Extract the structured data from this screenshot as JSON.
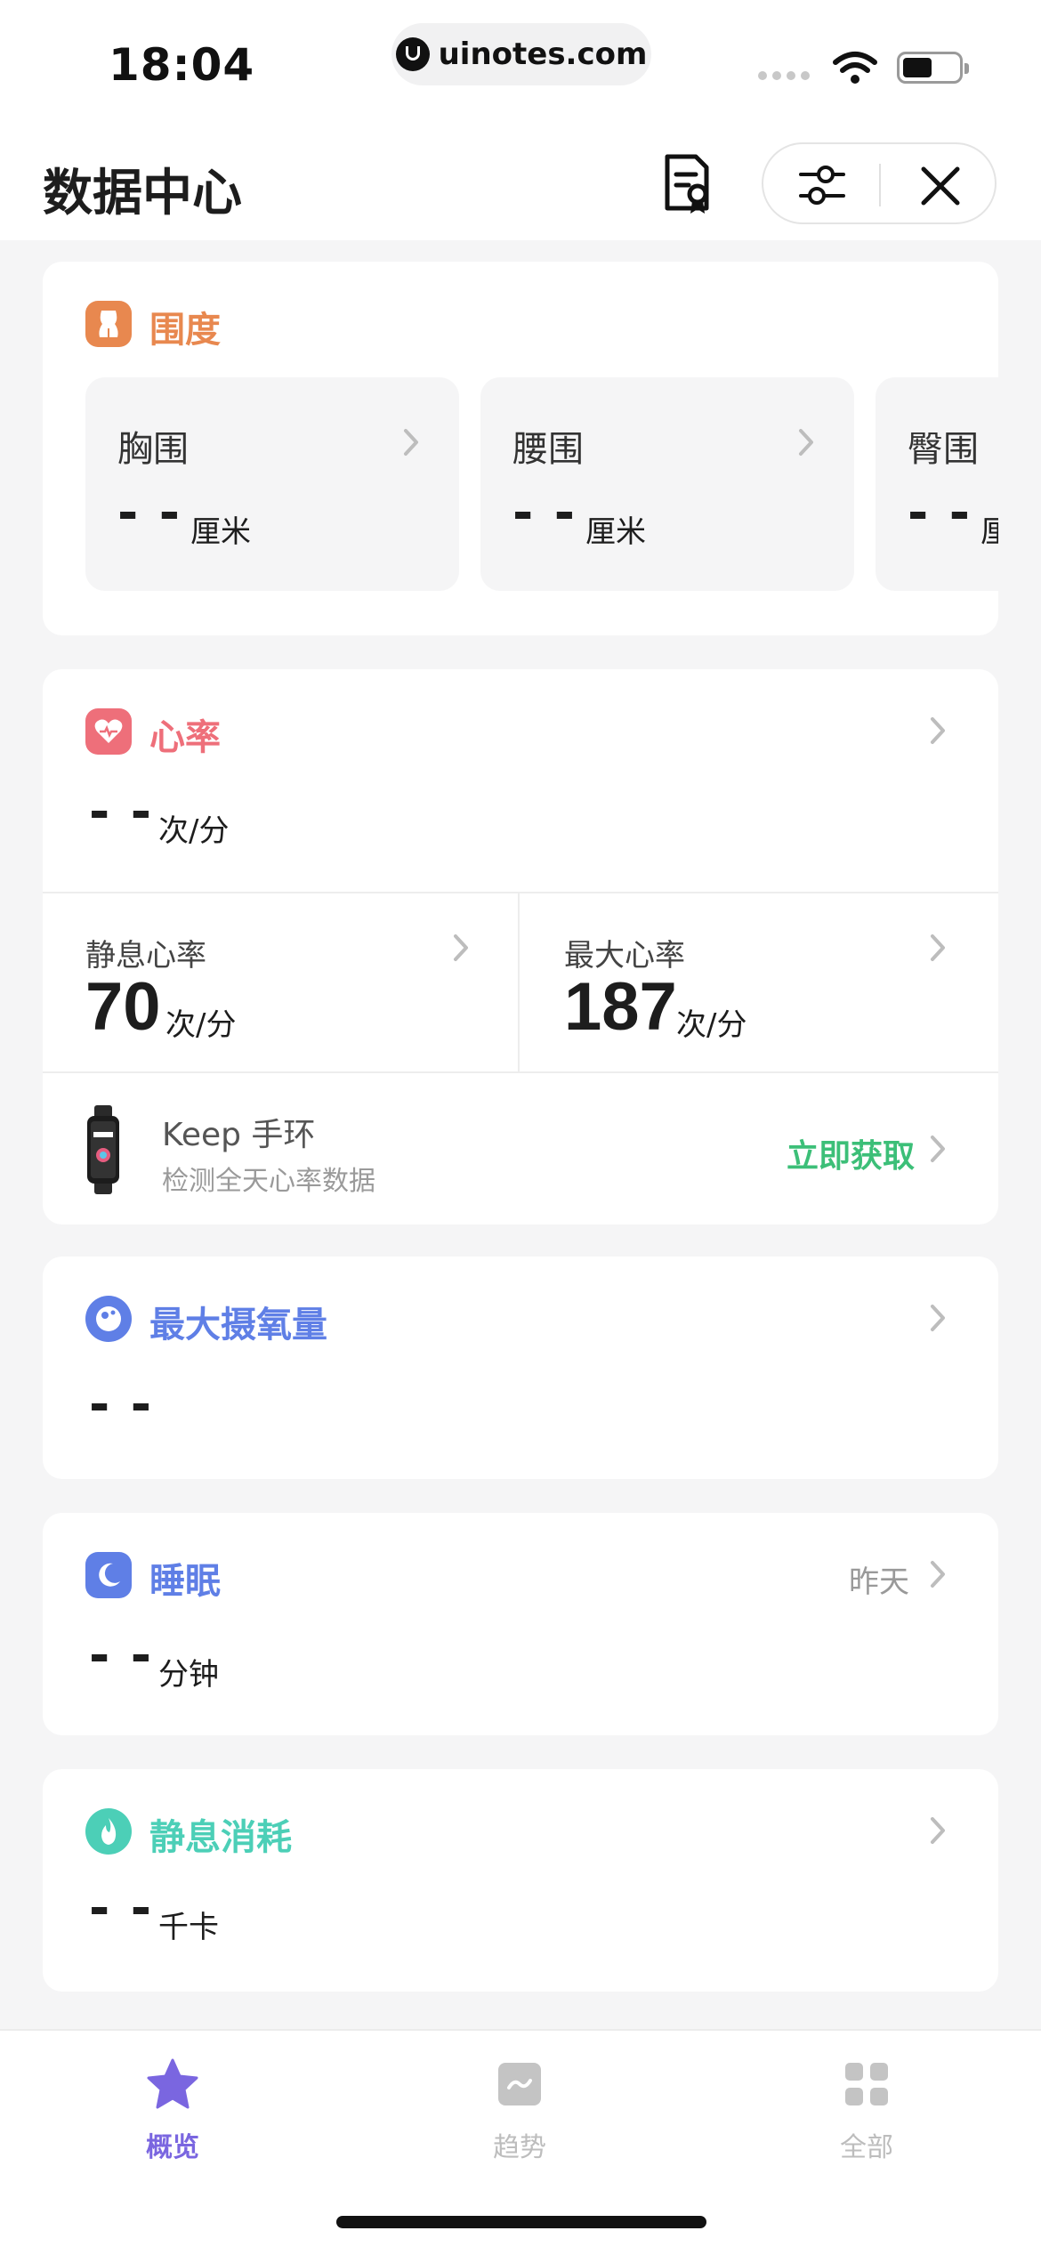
{
  "status": {
    "time": "18:04",
    "url": "uinotes.com"
  },
  "header": {
    "title": "数据中心"
  },
  "girth": {
    "title": "围度",
    "accent": "#e8884f",
    "items": [
      {
        "label": "胸围",
        "value": "- -",
        "unit": "厘米"
      },
      {
        "label": "腰围",
        "value": "- -",
        "unit": "厘米"
      },
      {
        "label": "臀围",
        "value": "- -",
        "unit": "厘米"
      }
    ]
  },
  "heart": {
    "title": "心率",
    "accent": "#ee6f7a",
    "value": "- -",
    "unit": "次/分",
    "resting": {
      "label": "静息心率",
      "value": "70",
      "unit": "次/分"
    },
    "max": {
      "label": "最大心率",
      "value": "187",
      "unit": "次/分"
    },
    "promo": {
      "title": "Keep 手环",
      "subtitle": "检测全天心率数据",
      "action": "立即获取"
    }
  },
  "vo2": {
    "title": "最大摄氧量",
    "accent": "#5f7fe6",
    "value": "- -"
  },
  "sleep": {
    "title": "睡眠",
    "accent": "#5f7fe6",
    "date": "昨天",
    "value": "- -",
    "unit": "分钟"
  },
  "resting_burn": {
    "title": "静息消耗",
    "accent": "#4ccfb7",
    "value": "- -",
    "unit": "千卡"
  },
  "tabs": [
    {
      "label": "概览",
      "active": true,
      "icon": "star-icon",
      "color": "#7a66e0"
    },
    {
      "label": "趋势",
      "active": false,
      "icon": "trend-icon",
      "color": "#c4c4c4"
    },
    {
      "label": "全部",
      "active": false,
      "icon": "grid-icon",
      "color": "#c4c4c4"
    }
  ]
}
